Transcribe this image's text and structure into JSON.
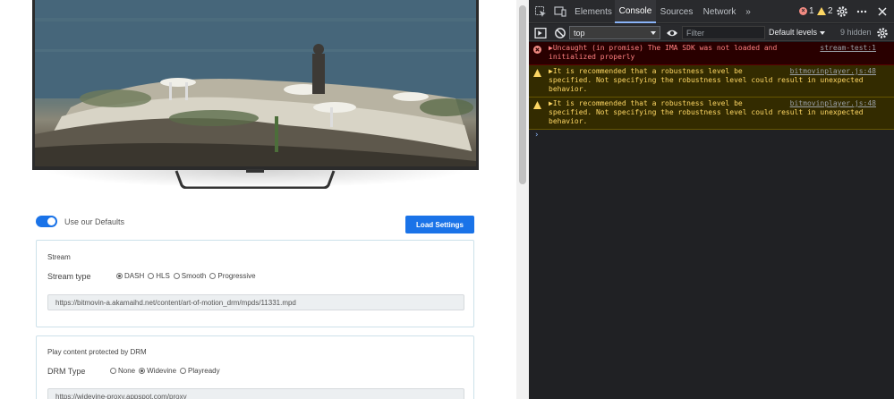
{
  "page": {
    "defaults_label": "Use our Defaults",
    "load_button": "Load Settings",
    "stream_card": {
      "title": "Stream",
      "type_label": "Stream type",
      "options": [
        "DASH",
        "HLS",
        "Smooth",
        "Progressive"
      ],
      "selected": "DASH",
      "url": "https://bitmovin-a.akamaihd.net/content/art-of-motion_drm/mpds/11331.mpd"
    },
    "drm_card": {
      "title": "Play content protected by DRM",
      "type_label": "DRM Type",
      "options": [
        "None",
        "Widevine",
        "Playready"
      ],
      "selected": "Widevine",
      "url": "https://widevine-proxy.appspot.com/proxy"
    }
  },
  "devtools": {
    "tabs": [
      "Elements",
      "Console",
      "Sources",
      "Network"
    ],
    "active_tab": "Console",
    "more_tabs": "»",
    "error_count": "1",
    "warning_count": "2",
    "context": "top",
    "filter_placeholder": "Filter",
    "levels": "Default levels",
    "hidden": "9 hidden",
    "messages": [
      {
        "level": "error",
        "text": "▶Uncaught (in promise) The IMA SDK was not loaded and\ninitialized properly",
        "source": "stream-test:1"
      },
      {
        "level": "warning",
        "text": "▶It is recommended that a robustness level be\nspecified. Not specifying the robustness level could result in unexpected\nbehavior.",
        "source": "bitmovinplayer.js:48"
      },
      {
        "level": "warning",
        "text": "▶It is recommended that a robustness level be\nspecified. Not specifying the robustness level could result in unexpected\nbehavior.",
        "source": "bitmovinplayer.js:48"
      }
    ],
    "prompt": "›"
  },
  "colors": {
    "accent": "#1a73e8",
    "devtools_bg": "#202124",
    "error_bg": "#290000",
    "warning_bg": "#332b00"
  }
}
